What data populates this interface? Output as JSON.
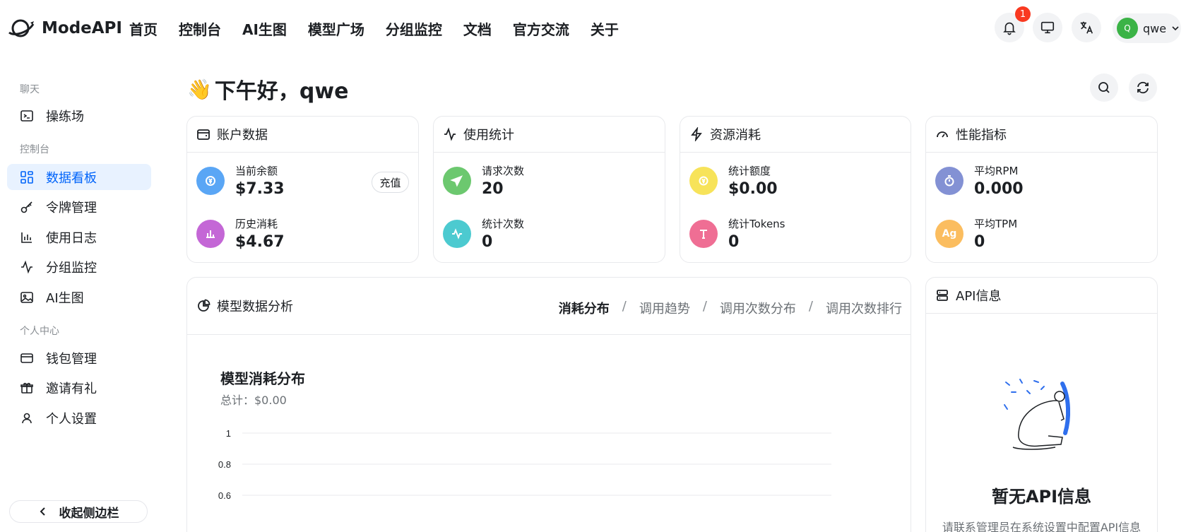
{
  "brand": {
    "name": "ModeAPI"
  },
  "nav": [
    {
      "label": "首页"
    },
    {
      "label": "控制台"
    },
    {
      "label": "AI生图"
    },
    {
      "label": "模型广场"
    },
    {
      "label": "分组监控"
    },
    {
      "label": "文档"
    },
    {
      "label": "官方交流"
    },
    {
      "label": "关于"
    }
  ],
  "header": {
    "notification_count": "1",
    "user": {
      "initial": "Q",
      "name": "qwe"
    }
  },
  "sidebar": {
    "groups": [
      {
        "label": "聊天"
      },
      {
        "label": "控制台"
      },
      {
        "label": "个人中心"
      }
    ],
    "items": [
      {
        "label": "操练场"
      },
      {
        "label": "数据看板"
      },
      {
        "label": "令牌管理"
      },
      {
        "label": "使用日志"
      },
      {
        "label": "分组监控"
      },
      {
        "label": "AI生图"
      },
      {
        "label": "钱包管理"
      },
      {
        "label": "邀请有礼"
      },
      {
        "label": "个人设置"
      }
    ],
    "collapse_label": "收起侧边栏"
  },
  "greeting": {
    "emoji": "👋",
    "text": "下午好，qwe"
  },
  "cards": {
    "account": {
      "title": "账户数据",
      "balance_label": "当前余额",
      "balance_value": "$7.33",
      "recharge_label": "充值",
      "history_label": "历史消耗",
      "history_value": "$4.67"
    },
    "usage": {
      "title": "使用统计",
      "requests_label": "请求次数",
      "requests_value": "20",
      "count_label": "统计次数",
      "count_value": "0"
    },
    "resource": {
      "title": "资源消耗",
      "quota_label": "统计额度",
      "quota_value": "$0.00",
      "tokens_label": "统计Tokens",
      "tokens_value": "0"
    },
    "performance": {
      "title": "性能指标",
      "rpm_label": "平均RPM",
      "rpm_value": "0.000",
      "tpm_label": "平均TPM",
      "tpm_value": "0",
      "tpm_icon_text": "Ag"
    }
  },
  "analysis": {
    "title": "模型数据分析",
    "tabs": [
      {
        "label": "消耗分布",
        "active": true
      },
      {
        "label": "调用趋势"
      },
      {
        "label": "调用次数分布"
      },
      {
        "label": "调用次数排行"
      }
    ],
    "chart_title": "模型消耗分布",
    "chart_total": "总计：$0.00"
  },
  "chart_data": {
    "type": "bar",
    "title": "模型消耗分布",
    "categories": [],
    "values": [],
    "y_ticks": [
      "1",
      "0.8",
      "0.6"
    ],
    "ylim": [
      0,
      1
    ],
    "grid": true
  },
  "api_info": {
    "title": "API信息",
    "empty_title": "暂无API信息",
    "empty_sub": "请联系管理员在系统设置中配置API信息"
  },
  "colors": {
    "accent": "#0064fa",
    "balance_icon": "#5aa6f5",
    "history_icon": "#c467d6",
    "requests_icon": "#6cc86f",
    "count_icon": "#4ccad0",
    "quota_icon": "#f7e35a",
    "tokens_icon": "#ef6e94",
    "rpm_icon": "#8391d4",
    "tpm_icon": "#fbbd5f"
  }
}
